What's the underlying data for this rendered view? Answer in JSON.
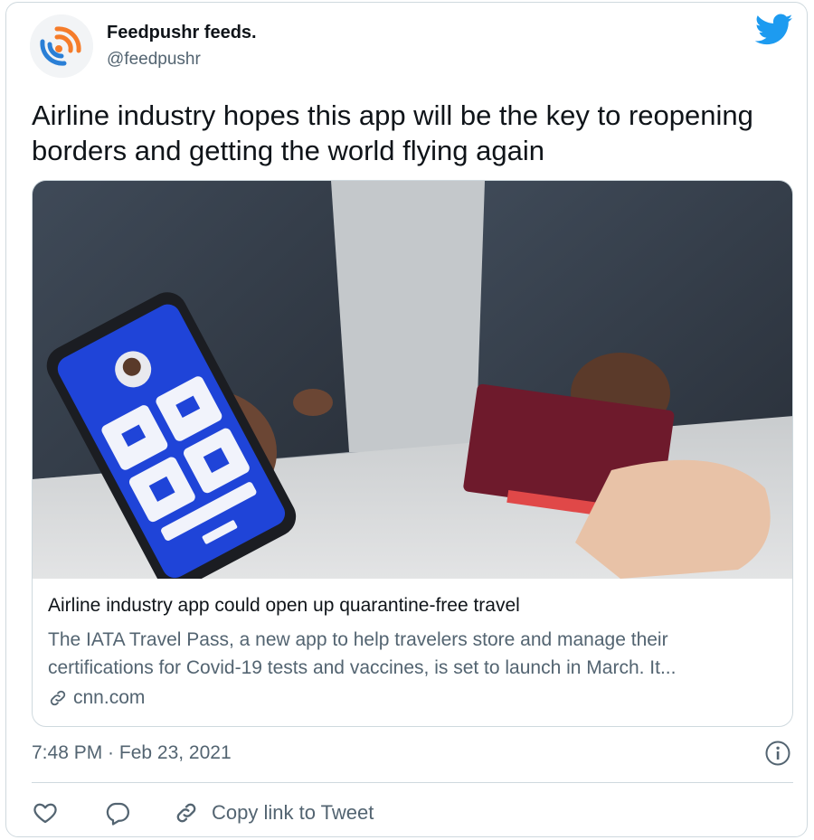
{
  "tweet": {
    "author_name": "Feedpushr feeds.",
    "author_handle": "@feedpushr",
    "text": "Airline industry hopes this app will be the key to reopening borders and getting the world flying again",
    "timestamp": "7:48 PM · Feb 23, 2021"
  },
  "link_card": {
    "title": "Airline industry app could open up quarantine-free travel",
    "description": "The IATA Travel Pass, a new app to help travelers store and manage their certifications for Covid-19 tests and vaccines, is set to launch in March. It...",
    "domain": "cnn.com"
  },
  "actions": {
    "copy_link_label": "Copy link to Tweet"
  },
  "icons": {
    "twitter": "twitter-bird-icon",
    "info": "info-icon",
    "like": "heart-icon",
    "reply": "reply-icon",
    "link": "link-icon"
  },
  "colors": {
    "twitter_blue": "#1d9bf0",
    "feedpushr_orange": "#f57c2a",
    "feedpushr_blue": "#2a7fd6",
    "secondary_text": "#536471",
    "border": "#cfd9de",
    "app_blue": "#1f44d8",
    "passport_red": "#6e1a2c"
  }
}
